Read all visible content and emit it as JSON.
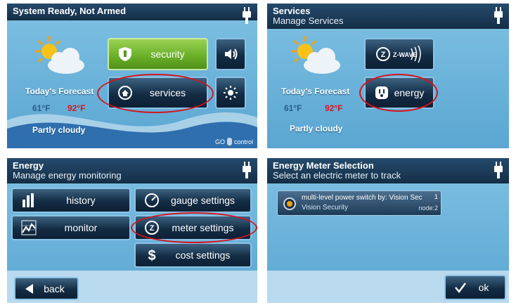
{
  "panel1": {
    "title": "System Ready, Not Armed",
    "forecast_label": "Today's Forecast",
    "low_temp": "61°F",
    "high_temp": "92°F",
    "condition": "Partly cloudy",
    "security_label": "security",
    "services_label": "services",
    "logo_text_left": "GO",
    "logo_text_right": "control"
  },
  "panel2": {
    "title": "Services",
    "subtitle": "Manage Services",
    "forecast_label": "Today's Forecast",
    "low_temp": "61°F",
    "high_temp": "92°F",
    "condition": "Partly cloudy",
    "zwave_label": "Z-WAVE",
    "energy_label": "energy"
  },
  "panel3": {
    "title": "Energy",
    "subtitle": "Manage energy monitoring",
    "history_label": "history",
    "gauge_label": "gauge settings",
    "monitor_label": "monitor",
    "meter_label": "meter settings",
    "cost_label": "cost settings",
    "back_label": "back"
  },
  "panel4": {
    "title": "Energy Meter Selection",
    "subtitle": "Select an electric meter to track",
    "meter_name": "multi-level power switch by: Vision Sec",
    "meter_vendor": "Vision Security",
    "meter_number": "1",
    "meter_node": "node:2",
    "ok_label": "ok"
  },
  "icons": [
    "plug-icon",
    "sun-cloud-icon",
    "shield-icon",
    "speaker-icon",
    "brightness-icon",
    "home-refresh-icon",
    "zwave-icon",
    "outlet-icon",
    "bar-chart-icon",
    "gauge-icon",
    "line-chart-icon",
    "zwave-small-icon",
    "dollar-icon",
    "back-arrow-icon",
    "checkmark-icon"
  ],
  "colors": {
    "highlight_ring": "#d4141c",
    "title_bar": "#1c3c5a",
    "panel_bg": "#6fb6de",
    "security_green": "#7cc13a",
    "sun": "#f4a20e"
  }
}
